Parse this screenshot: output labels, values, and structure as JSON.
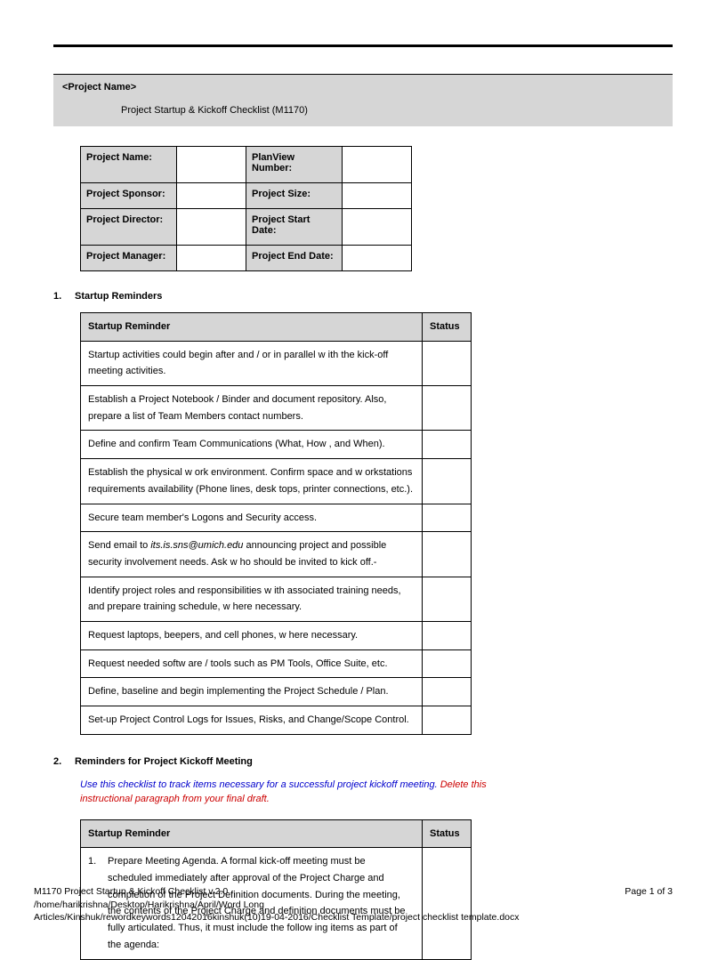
{
  "header": {
    "placeholder": "<Project Name>",
    "subtitle": "Project Startup & Kickoff Checklist (M1170)"
  },
  "info_rows": [
    {
      "left_label": "Project Name:",
      "right_label": "PlanView Number:"
    },
    {
      "left_label": "Project Sponsor:",
      "right_label": "Project Size:"
    },
    {
      "left_label": "Project Director:",
      "right_label": "Project Start Date:"
    },
    {
      "left_label": "Project Manager:",
      "right_label": "Project End Date:"
    }
  ],
  "section1": {
    "num": "1.",
    "title": "Startup Reminders"
  },
  "startup_header": {
    "col1": "Startup Reminder",
    "col2": "Status"
  },
  "startup_rows": [
    {
      "html": "Startup activities could begin after and / or in parallel w ith the kick-off meeting activities."
    },
    {
      "html": "Establish a Project Notebook / Binder and document repository. Also, prepare a list of Team Members contact numbers."
    },
    {
      "html": "Define and confirm Team Communications (What, How , and When)."
    },
    {
      "html": "Establish the physical w ork environment. Confirm space and w orkstations requirements availability (Phone lines, desk tops, printer connections, etc.)."
    },
    {
      "html": "Secure team member's Logons and Security access."
    },
    {
      "html": "Send email to <span class='em-italic'>its.is.sns@umich.edu</span> announcing project and possible security involvement needs.  Ask w ho should be invited to kick off.-"
    },
    {
      "html": "Identify project roles and responsibilities w ith associated training needs, and prepare training schedule, w here necessary."
    },
    {
      "html": "Request laptops, beepers, and cell phones, w here necessary."
    },
    {
      "html": "Request needed softw are / tools such as PM Tools, Office Suite, etc."
    },
    {
      "html": "Define, baseline and begin implementing the Project Schedule / Plan."
    },
    {
      "html": "Set-up Project Control Logs for Issues, Risks, and Change/Scope Control."
    }
  ],
  "section2": {
    "num": "2.",
    "title": "Reminders for Project Kickoff Meeting"
  },
  "instruction": {
    "blue": "Use this checklist to track items necessary for a successful project kickoff meeting.",
    "red": "Delete this instructional paragraph from your final draft."
  },
  "kickoff_header": {
    "col1": "Startup Reminder",
    "col2": "Status"
  },
  "kickoff_rows": [
    {
      "num": "1.",
      "body": "Prepare Meeting Agenda. A formal kick-off meeting must be scheduled immediately after approval of the Project Charge and completion of the Project Definition documents. During the meeting, the contents of the Project Charge and definition documents must be fully articulated. Thus, it must include the follow ing items as part of the agenda:"
    }
  ],
  "footer": {
    "line1": "M1170 Project Startup & Kickoff Checklist v.2.0",
    "page": "Page 1 of 3",
    "line2": "/home/harikrishna/Desktop/Harikrishna/April/Word Long",
    "line3": "Articles/Kinshuk/rewordkeywords12042016kinshuk(10)19-04-2016/Checklist Template/project checklist template.docx"
  }
}
